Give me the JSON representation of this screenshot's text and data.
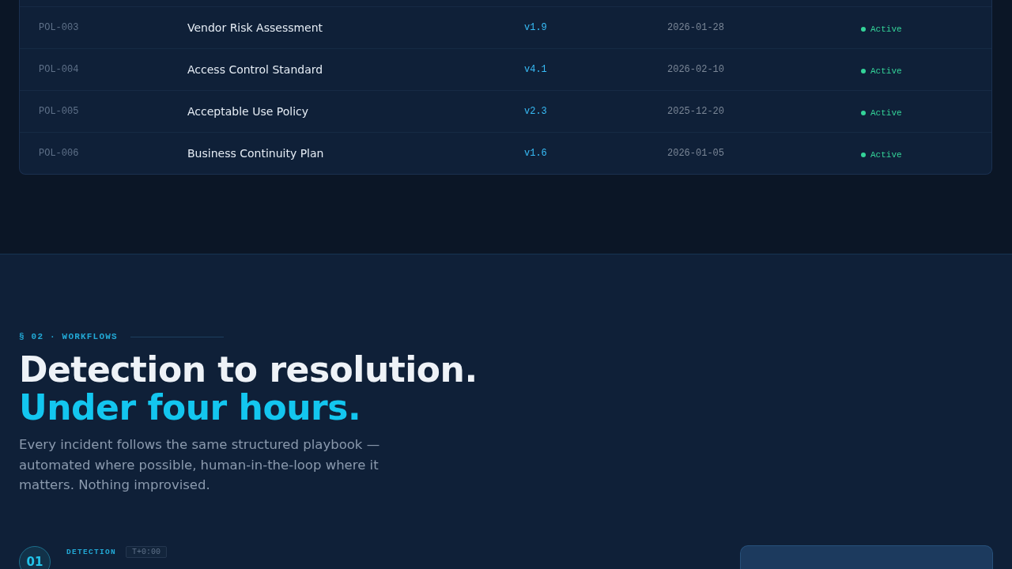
{
  "policies": {
    "rows": [
      {
        "id": "POL-003",
        "name": "Vendor Risk Assessment",
        "version": "v1.9",
        "date": "2026-01-28",
        "status": "Active",
        "color": "#34d399"
      },
      {
        "id": "POL-004",
        "name": "Access Control Standard",
        "version": "v4.1",
        "date": "2026-02-10",
        "status": "Active",
        "color": "#34d399"
      },
      {
        "id": "POL-005",
        "name": "Acceptable Use Policy",
        "version": "v2.3",
        "date": "2025-12-20",
        "status": "Active",
        "color": "#34d399"
      },
      {
        "id": "POL-006",
        "name": "Business Continuity Plan",
        "version": "v1.6",
        "date": "2026-01-05",
        "status": "Active",
        "color": "#34d399"
      }
    ]
  },
  "workflows": {
    "eyebrow": "§ 02 · WORKFLOWS",
    "heading": "Detection to resolution.",
    "heading_accent": "Under four hours.",
    "description": "Every incident follows the same structured playbook — automated where possible, human-in-the-loop where it matters. Nothing improvised.",
    "steps": [
      {
        "number": "01",
        "label": "DETECTION",
        "time": "T+0:00"
      }
    ]
  }
}
